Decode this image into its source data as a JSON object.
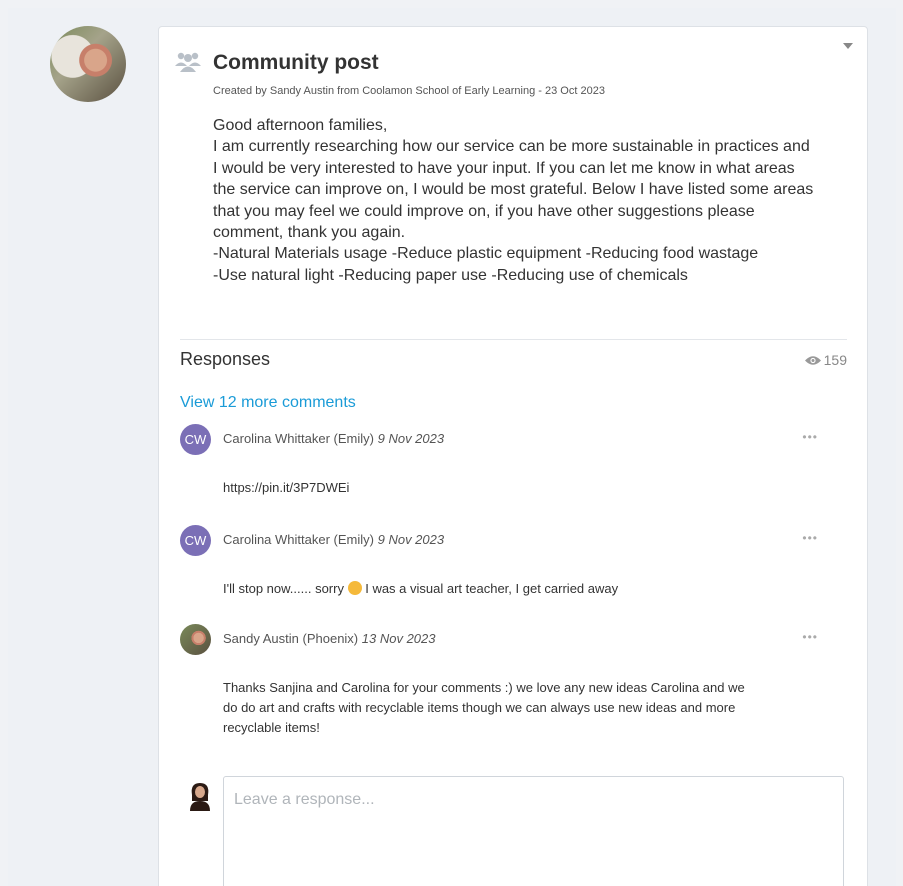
{
  "post": {
    "title": "Community post",
    "meta": "Created by Sandy Austin from Coolamon School of Early Learning - 23 Oct 2023",
    "body_lines": [
      "Good afternoon families,",
      "I am currently researching how our service can be more sustainable in practices and",
      "I would be very interested to have your input. If you can let me know in what areas",
      "the service can improve on, I would be most grateful. Below I have listed some areas",
      "that you may feel we could improve on, if you have other suggestions please",
      "comment, thank you again.",
      "-Natural Materials usage -Reduce plastic equipment -Reducing food wastage",
      "-Use natural light -Reducing paper use -Reducing use of chemicals"
    ]
  },
  "responses": {
    "title": "Responses",
    "views": "159",
    "view_more": "View 12 more comments",
    "comments": [
      {
        "initials": "CW",
        "author": "Carolina Whittaker (Emily)",
        "date": "9 Nov 2023",
        "more": "•••",
        "text": "https://pin.it/3P7DWEi"
      },
      {
        "initials": "CW",
        "author": "Carolina Whittaker (Emily)",
        "date": "9 Nov 2023",
        "more": "•••",
        "text_before": "I'll stop now...... sorry",
        "text_after": "I was a visual art teacher, I get carried away"
      },
      {
        "author": "Sandy Austin (Phoenix)",
        "date": "13 Nov 2023",
        "more": "•••",
        "text_lines": [
          "Thanks Sanjina and Carolina for your comments :) we love any new ideas Carolina and we",
          "do do art and crafts with recyclable items though we can always use new ideas and more",
          "recyclable items!"
        ]
      }
    ],
    "placeholder": "Leave a response..."
  },
  "colors": {
    "accent": "#1a9bd7",
    "initials_avatar": "#7b6fb6"
  },
  "icons": [
    "group-icon",
    "chevron-down-icon",
    "eye-icon",
    "more-icon",
    "emoji-icon"
  ]
}
